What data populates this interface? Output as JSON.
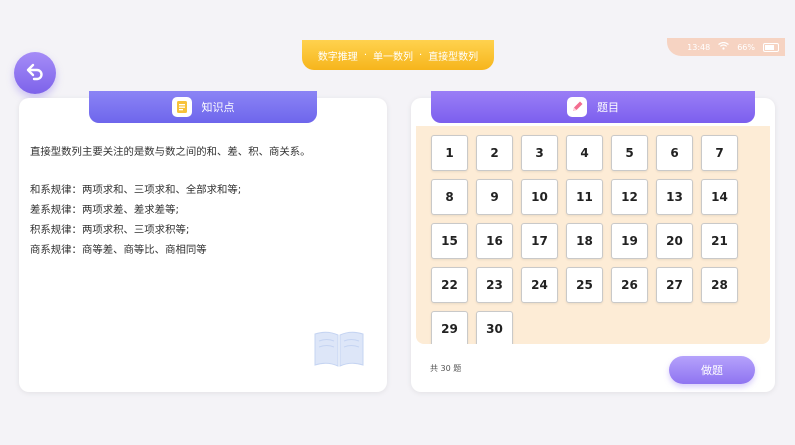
{
  "status": {
    "time": "13:48",
    "battery": "66%"
  },
  "breadcrumb": {
    "items": [
      "数字推理",
      "单一数列",
      "直接型数列"
    ],
    "separator": "·"
  },
  "knowledge": {
    "title": "知识点",
    "intro": "直接型数列主要关注的是数与数之间的和、差、积、商关系。",
    "rules": [
      "和系规律：两项求和、三项求和、全部求和等;",
      "差系规律：两项求差、差求差等;",
      "积系规律：两项求积、三项求积等;",
      "商系规律：商等差、商等比、商相同等"
    ]
  },
  "questions": {
    "title": "题目",
    "numbers": [
      "1",
      "2",
      "3",
      "4",
      "5",
      "6",
      "7",
      "8",
      "9",
      "10",
      "11",
      "12",
      "13",
      "14",
      "15",
      "16",
      "17",
      "18",
      "19",
      "20",
      "21",
      "22",
      "23",
      "24",
      "25",
      "26",
      "27",
      "28",
      "29",
      "30"
    ],
    "total_label": "共 30 题",
    "action_label": "做题"
  },
  "colors": {
    "accent": "#7c5fee",
    "breadcrumb": "#f6b51c",
    "grid_bg": "#fdecd6"
  }
}
